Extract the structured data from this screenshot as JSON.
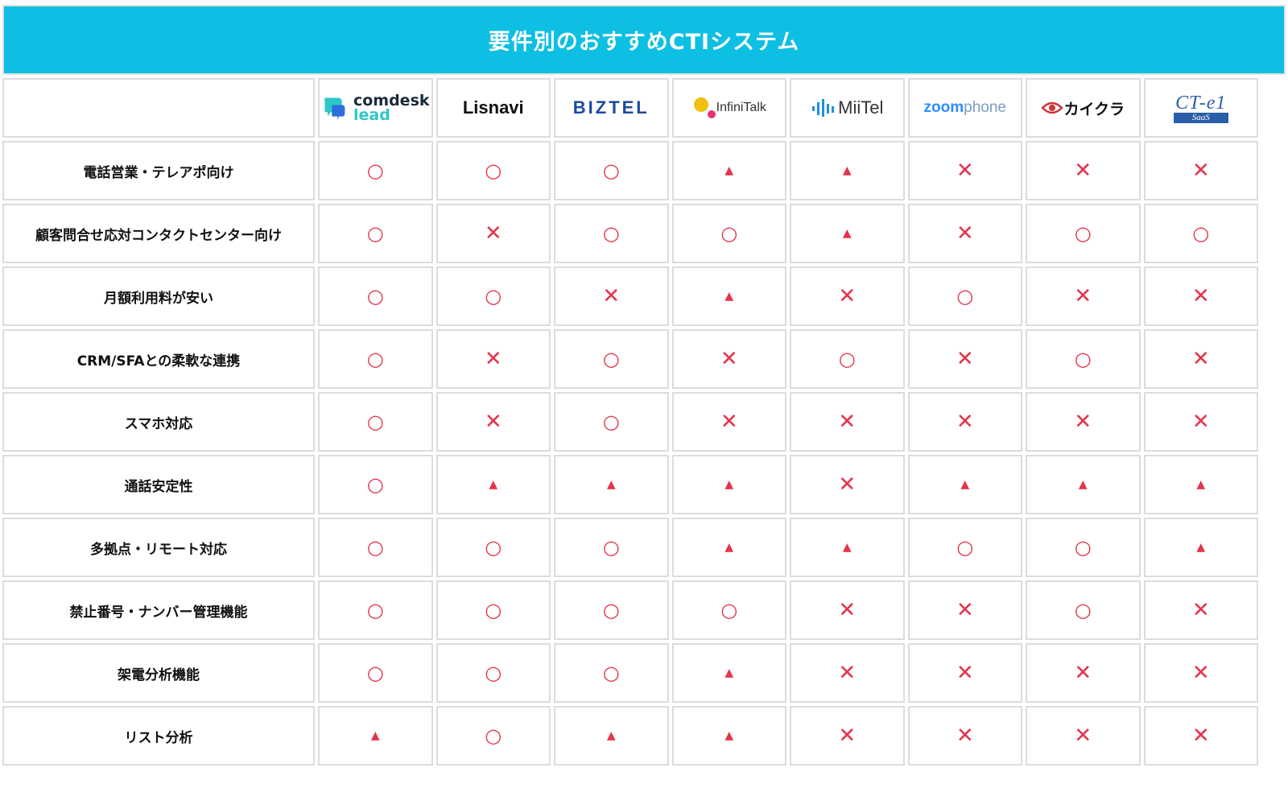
{
  "title": "要件別のおすすめCTIシステム",
  "vendors": [
    {
      "key": "comdesk",
      "line1": "comdesk",
      "line2": "lead",
      "icon": "chat-bubble-icon",
      "colors": [
        "#2ec7c9",
        "#2a6fdb"
      ]
    },
    {
      "key": "lisnavi",
      "name": "Lisnavi"
    },
    {
      "key": "biztel",
      "name": "BIZTEL",
      "color": "#1c4aa0"
    },
    {
      "key": "infinitalk",
      "name": "InfiniTalk",
      "icon": "dots-icon",
      "colors": [
        "#f0c010",
        "#e8336b"
      ]
    },
    {
      "key": "miitel",
      "name": "MiiTel",
      "icon": "sound-bars-icon",
      "color": "#1e8fe0"
    },
    {
      "key": "zoomphone",
      "part1": "zoom",
      "part2": "phone"
    },
    {
      "key": "kaikura",
      "name": "カイクラ",
      "icon": "eye-icon",
      "color": "#d0343b"
    },
    {
      "key": "ctel",
      "line1": "CT-e1",
      "line2": "SaaS",
      "color": "#2a5ea8"
    }
  ],
  "mark_symbols": {
    "circle": "○",
    "cross": "✕",
    "triangle": "▲"
  },
  "mark_color": "#e5334b",
  "header_color": "#0dbfe2",
  "rows": [
    {
      "label": "電話営業・テレアポ向け",
      "marks": [
        "circle",
        "circle",
        "circle",
        "triangle",
        "triangle",
        "cross",
        "cross",
        "cross"
      ]
    },
    {
      "label": "顧客問合せ応対コンタクトセンター向け",
      "marks": [
        "circle",
        "cross",
        "circle",
        "circle",
        "triangle",
        "cross",
        "circle",
        "circle"
      ]
    },
    {
      "label": "月額利用料が安い",
      "marks": [
        "circle",
        "circle",
        "cross",
        "triangle",
        "cross",
        "circle",
        "cross",
        "cross"
      ]
    },
    {
      "label": "CRM/SFAとの柔軟な連携",
      "marks": [
        "circle",
        "cross",
        "circle",
        "cross",
        "circle",
        "cross",
        "circle",
        "cross"
      ]
    },
    {
      "label": "スマホ対応",
      "marks": [
        "circle",
        "cross",
        "circle",
        "cross",
        "cross",
        "cross",
        "cross",
        "cross"
      ]
    },
    {
      "label": "通話安定性",
      "marks": [
        "circle",
        "triangle",
        "triangle",
        "triangle",
        "cross",
        "triangle",
        "triangle",
        "triangle"
      ]
    },
    {
      "label": "多拠点・リモート対応",
      "marks": [
        "circle",
        "circle",
        "circle",
        "triangle",
        "triangle",
        "circle",
        "circle",
        "triangle"
      ]
    },
    {
      "label": "禁止番号・ナンバー管理機能",
      "marks": [
        "circle",
        "circle",
        "circle",
        "circle",
        "cross",
        "cross",
        "circle",
        "cross"
      ]
    },
    {
      "label": "架電分析機能",
      "marks": [
        "circle",
        "circle",
        "circle",
        "triangle",
        "cross",
        "cross",
        "cross",
        "cross"
      ]
    },
    {
      "label": "リスト分析",
      "marks": [
        "triangle",
        "circle",
        "triangle",
        "triangle",
        "cross",
        "cross",
        "cross",
        "cross"
      ]
    }
  ]
}
